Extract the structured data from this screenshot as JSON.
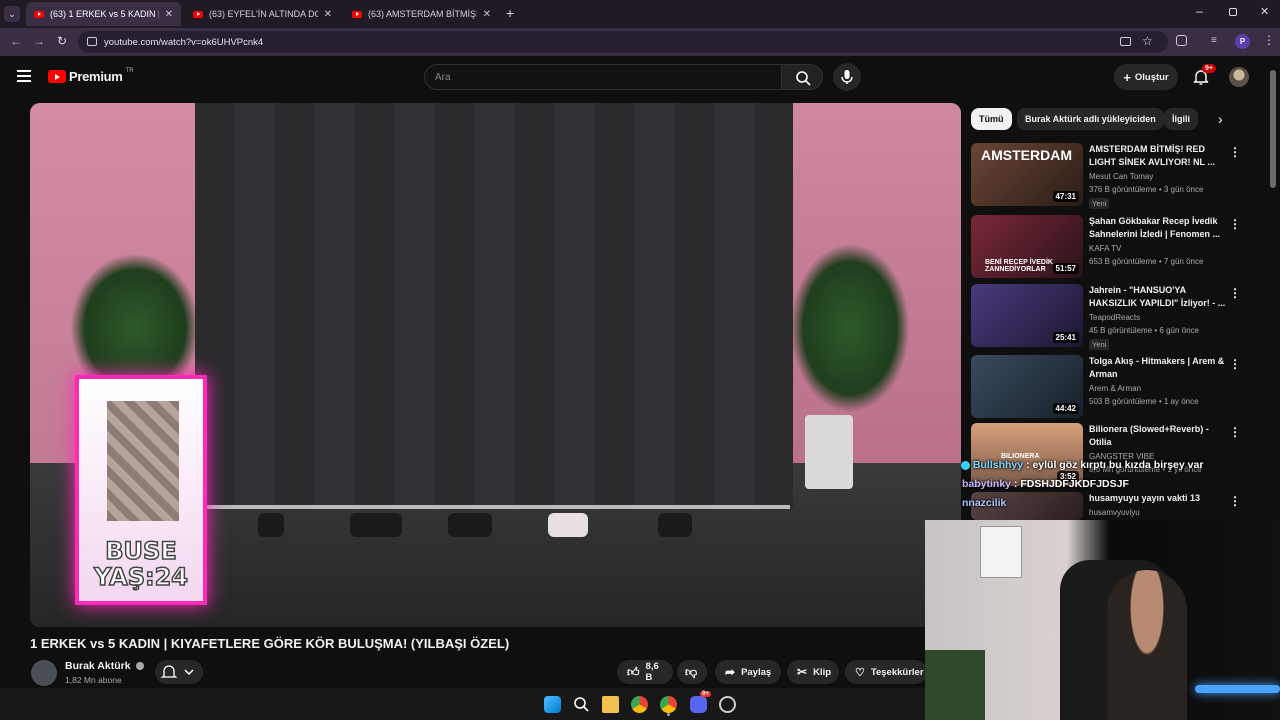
{
  "browser": {
    "tabs": [
      {
        "label": "(63) 1 ERKEK vs 5 KADIN | KIYAFETLER GÖRE",
        "active": true
      },
      {
        "label": "(63) EYFEL'İN ALTINDA DOLANDIRI",
        "active": false
      },
      {
        "label": "(63) AMSTERDAM BİTMİŞ! RED",
        "active": false
      }
    ],
    "url": "youtube.com/watch?v=ok6UHVPcnk4",
    "profile_initial": "P"
  },
  "youtube": {
    "logo_text": "Premium",
    "logo_sup": "TR",
    "search_placeholder": "Ara",
    "create_label": "Oluştur",
    "notif_count": "9+"
  },
  "video": {
    "card_name": "BUSE",
    "card_age": "YAŞ:24",
    "title": "1 ERKEK vs 5 KADIN | KIYAFETLERE GÖRE KÖR BULUŞMA! (YILBAŞI ÖZEL)",
    "channel": "Burak Aktürk",
    "subscribers": "1,82 Mn abone",
    "likes": "8,6 B",
    "share_label": "Paylaş",
    "clip_label": "Klip",
    "thanks_label": "Teşekkürler"
  },
  "sidebar": {
    "chips": [
      "Tümü",
      "Burak Aktürk adlı yükleyiciden",
      "İlgili"
    ],
    "items": [
      {
        "title": "AMSTERDAM BİTMİŞ! RED LIGHT SİNEK AVLIYOR! NL ...",
        "channel": "Mesut Can Tomay",
        "meta": "376 B görüntüleme • 3 gün önce",
        "badge": "Yeni",
        "duration": "47:31",
        "thumb_color": "#5a3a2e"
      },
      {
        "title": "Şahan Gökbakar Recep İvedik Sahnelerini İzledi | Fenomen ...",
        "channel": "KAFA TV",
        "meta": "653 B görüntüleme • 7 gün önce",
        "badge": "",
        "duration": "51:57",
        "thumb_color": "#6b2330"
      },
      {
        "title": "Jahrein - \"HANSUO'YA HAKSIZLIK YAPILDI\" İzliyor! - ...",
        "channel": "TeapodReacts",
        "meta": "45 B görüntüleme • 6 gün önce",
        "badge": "Yeni",
        "duration": "25:41",
        "thumb_color": "#3a2f5e"
      },
      {
        "title": "Tolga Akış - Hitmakers | Arem & Arman",
        "channel": "Arem & Arman",
        "meta": "503 B görüntüleme • 1 ay önce",
        "badge": "",
        "duration": "44:42",
        "thumb_color": "#2b3a4a"
      },
      {
        "title": "Bilionera (Slowed+Reverb) - Otilia",
        "channel": "GANGSTER VIBE",
        "meta": "8,6 Mn görüntüleme • 1 yıl önce",
        "badge": "",
        "duration": "3:52",
        "thumb_color": "#b07a5a"
      },
      {
        "title": "husamyuyu yayın vakti 13",
        "channel": "husamvyuviyu",
        "meta": "",
        "badge": "",
        "duration": "",
        "thumb_color": "#4a3a3a"
      }
    ]
  },
  "chat_overlay": [
    {
      "user": "Bullshhyy",
      "message": "eylül göz kırptı bu kızda birşey var"
    },
    {
      "user": "babytinky",
      "message": "FDSHJDFJKDFJDSJF"
    },
    {
      "user": "nnazcilik",
      "message": ""
    }
  ],
  "taskbar": {
    "discord_badge": "9+"
  },
  "colors": {
    "yt_red": "#ff0000",
    "card_border": "#ff2ab8",
    "tab_active": "#3a2e45"
  }
}
